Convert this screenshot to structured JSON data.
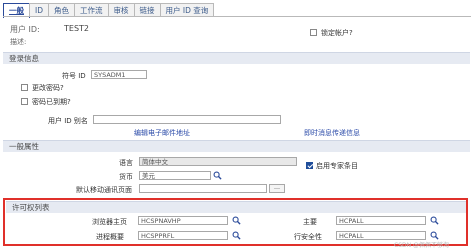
{
  "tabs": [
    "一般",
    "ID",
    "角色",
    "工作流",
    "审核",
    "链接",
    "用户 ID 查询"
  ],
  "user": {
    "id_label": "用户 ID:",
    "id_value": "TEST2",
    "desc_label": "描述:",
    "lock_label": "锁定帐户?"
  },
  "login": {
    "header": "登录信息",
    "symbol_label": "符号 ID",
    "symbol_value": "SYSADM1",
    "change_pwd_label": "更改密码?",
    "pwd_expired_label": "密码已到期?",
    "alias_label": "用户 ID 别名",
    "email_link": "编辑电子邮件地址",
    "im_link": "即时消息传递信息"
  },
  "general": {
    "header": "一般属性",
    "lang_label": "语言",
    "lang_value": "简体中文",
    "currency_label": "货币",
    "currency_value": "美元",
    "expert_label": "启用专家条目",
    "mobile_label": "默认移动通讯页面"
  },
  "permissions": {
    "header": "许可权列表",
    "navigator_label": "浏览器主页",
    "navigator_value": "HCSPNAVHP",
    "main_label": "主要",
    "main_value": "HCPALL",
    "process_label": "进程概要",
    "process_value": "HCSPPRFL",
    "rowsec_label": "行安全性",
    "rowsec_value": "HCPALL"
  },
  "watermark": "CSDN @佩佩不够淘",
  "colors": {
    "accent": "#2a4a9a",
    "highlight_border": "#e0302a",
    "section_bg": "#e6eaf2"
  }
}
